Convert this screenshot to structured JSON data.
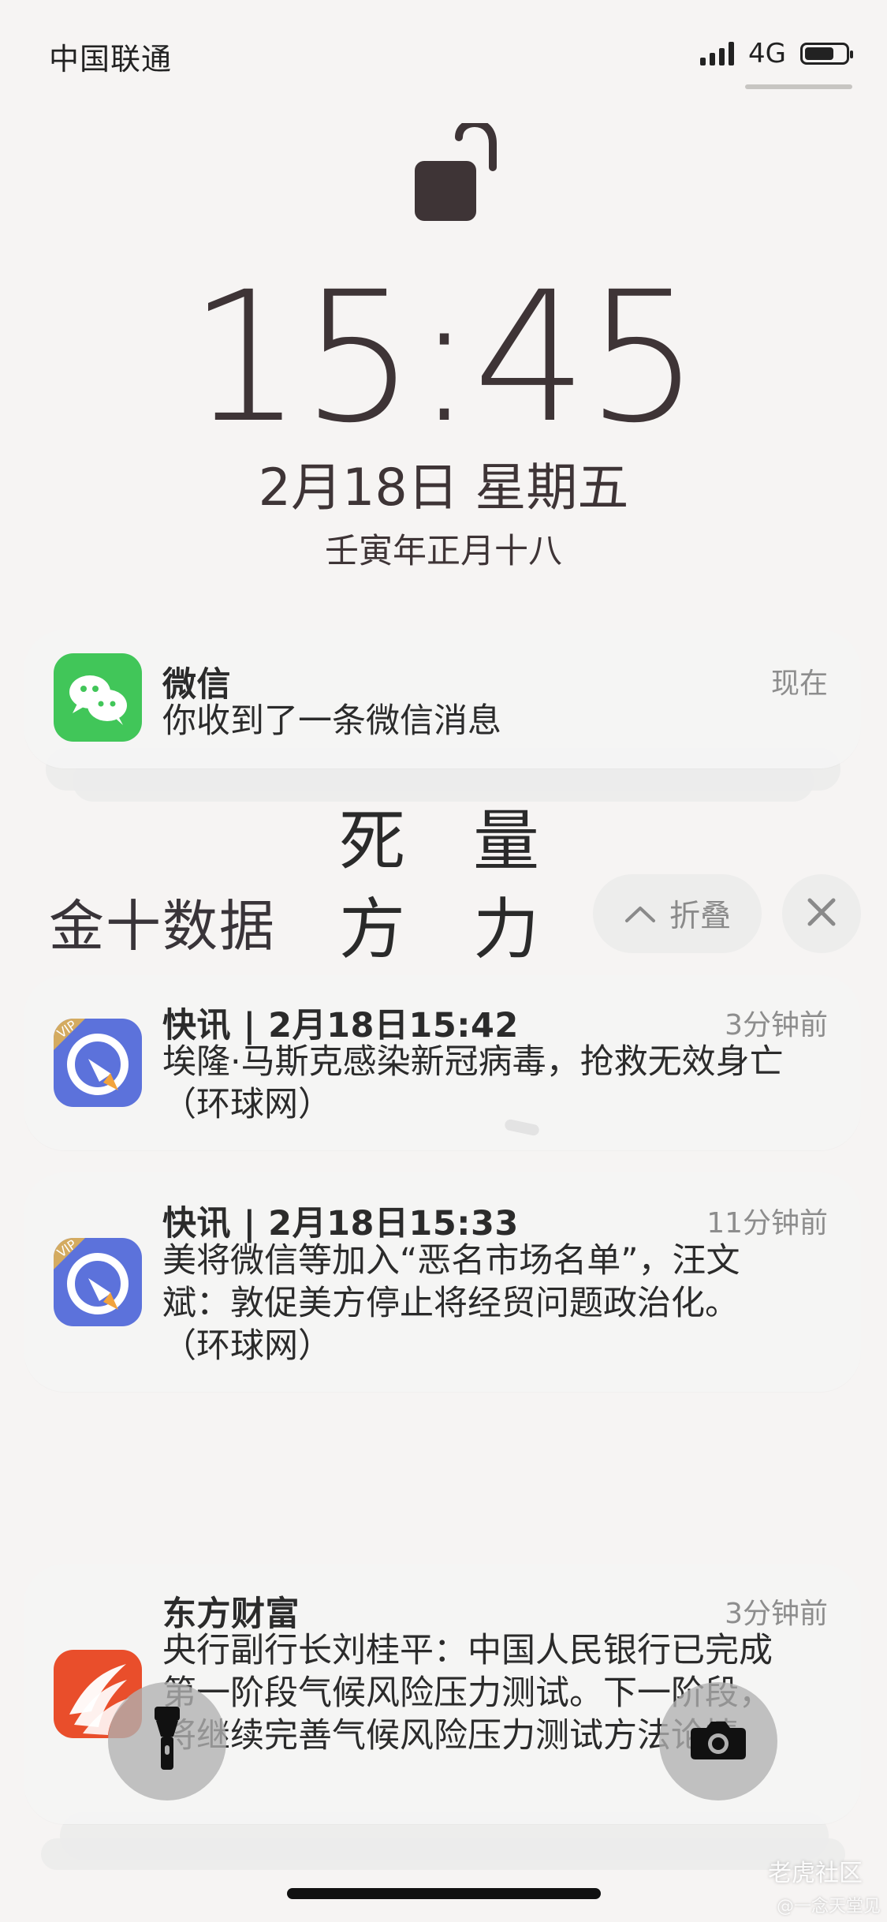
{
  "status_bar": {
    "carrier": "中国联通",
    "network": "4G"
  },
  "lock_screen": {
    "time": "15:45",
    "date": "2月18日 星期五",
    "lunar": "壬寅年正月十八"
  },
  "wallpaper": {
    "characters": [
      "死",
      "量",
      "方",
      "力"
    ]
  },
  "wechat_notification": {
    "app": "微信",
    "time": "现在",
    "message": "你收到了一条微信消息",
    "icon": "wechat-icon"
  },
  "jinshi_group": {
    "title": "金十数据",
    "collapse_label": "折叠",
    "collapse_icon": "chevron-up-icon",
    "close_icon": "close-icon",
    "notifications": [
      {
        "title": "快讯 | 2月18日15:42",
        "time": "3分钟前",
        "body": "埃隆·马斯克感染新冠病毒，抢救无效身亡\n（环球网）",
        "icon": "jinshi-data-app-icon",
        "vip": "VIP"
      },
      {
        "title": "快讯 | 2月18日15:33",
        "time": "11分钟前",
        "body": "美将微信等加入“恶名市场名单”，汪文\n斌：敦促美方停止将经贸问题政治化。\n（环球网）",
        "icon": "jinshi-data-app-icon",
        "vip": "VIP"
      }
    ]
  },
  "eastmoney_notification": {
    "app": "东方财富",
    "time": "3分钟前",
    "body": "央行副行长刘桂平：中国人民银行已完成\n第一阶段气候风险压力测试。下一阶段，\n将继续完善气候风险压力测试方法论情",
    "icon": "eastmoney-app-icon"
  },
  "bottom_controls": {
    "flashlight": "flashlight-icon",
    "camera": "camera-icon"
  },
  "watermark": {
    "main": "老虎社区",
    "sub": "@一念天堂见"
  },
  "colors": {
    "text_dark": "#3e3436",
    "wechat_green": "#41c659",
    "jinshi_blue": "#5c72db",
    "eastmoney_orange": "#e94e2b"
  }
}
